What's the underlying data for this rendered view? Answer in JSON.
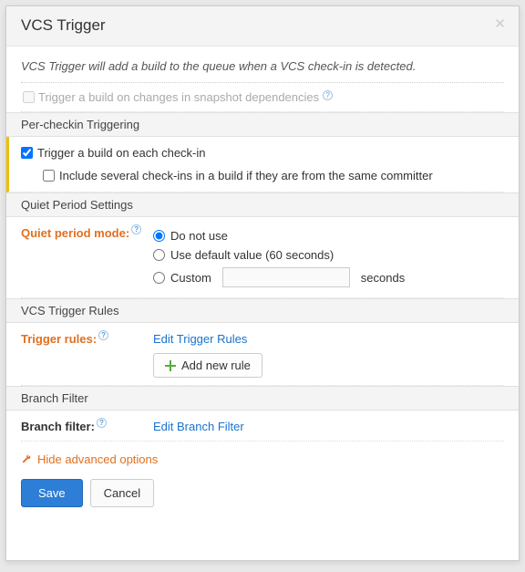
{
  "dialog": {
    "title": "VCS Trigger",
    "intro": "VCS Trigger will add a build to the queue when a VCS check-in is detected."
  },
  "snapshot": {
    "label": "Trigger a build on changes in snapshot dependencies",
    "checked": false,
    "disabled": true
  },
  "perCheckin": {
    "header": "Per-checkin Triggering",
    "buildEach": {
      "label": "Trigger a build on each check-in",
      "checked": true
    },
    "includeSeveral": {
      "label": "Include several check-ins in a build if they are from the same committer",
      "checked": false
    }
  },
  "quiet": {
    "header": "Quiet Period Settings",
    "label": "Quiet period mode:",
    "options": {
      "doNotUse": "Do not use",
      "useDefault": "Use default value (60 seconds)",
      "custom": "Custom",
      "customSuffix": "seconds"
    },
    "selected": "doNotUse",
    "customValue": ""
  },
  "rules": {
    "header": "VCS Trigger Rules",
    "label": "Trigger rules:",
    "editLink": "Edit Trigger Rules",
    "addBtn": "Add new rule"
  },
  "branch": {
    "header": "Branch Filter",
    "label": "Branch filter:",
    "editLink": "Edit Branch Filter"
  },
  "advanced": {
    "toggle": "Hide advanced options"
  },
  "footer": {
    "save": "Save",
    "cancel": "Cancel"
  }
}
